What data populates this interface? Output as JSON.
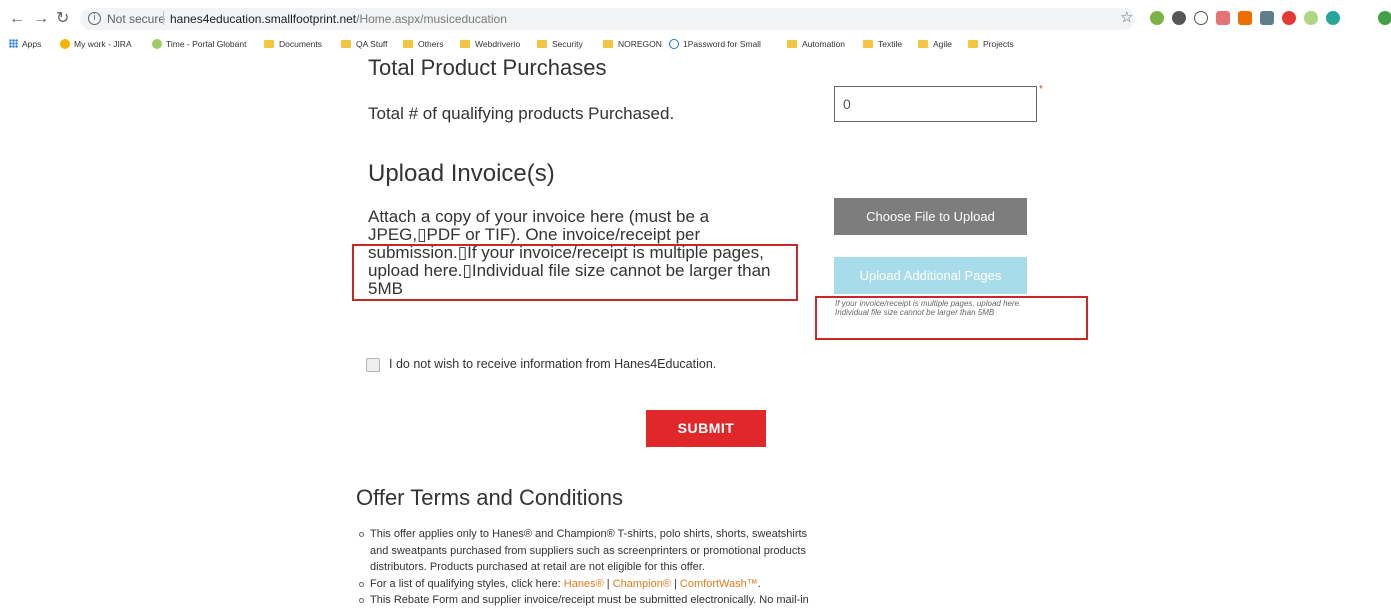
{
  "browser": {
    "not_secure": "Not secure",
    "url_host": "hanes4education.smallfootprint.net",
    "url_path": "/Home.aspx/musiceducation",
    "bookmarks": [
      "Apps",
      "My work - JIRA",
      "Time - Portal Globant",
      "Documents",
      "QA Stuff",
      "Others",
      "Webdriverio",
      "Security",
      "NOREGON",
      "1Password for Small",
      "Automation",
      "Textile",
      "Agile",
      "Projects"
    ]
  },
  "form": {
    "purchases_heading": "Total Product Purchases",
    "qty_label": "Total # of qualifying products Purchased.",
    "qty_value": "0",
    "required_marker": "*",
    "upload_heading": "Upload Invoice(s)",
    "attach_line1": "Attach a copy of your invoice here (must be a",
    "attach_line2": "JPEG,▯PDF or TIF). One invoice/receipt per",
    "attach_line3": "submission.▯If your invoice/receipt is multiple pages,",
    "attach_line4": "upload here.▯Individual file size cannot be larger than",
    "attach_line5": "5MB",
    "choose_file_label": "Choose File to Upload",
    "additional_pages_label": "Upload Additional Pages",
    "hint_text": "If your invoice/receipt is multiple pages, upload here. Individual file size cannot be larger than 5MB",
    "optout_label": "I do not wish to receive information from Hanes4Education.",
    "submit_label": "SUBMIT"
  },
  "terms": {
    "heading": "Offer Terms and Conditions",
    "item1": "This offer applies only to Hanes® and Champion® T-shirts, polo shirts, shorts, sweatshirts and sweatpants purchased from suppliers such as screenprinters or promotional products distributors. Products purchased at retail are not eligible for this offer.",
    "item2_prefix": "For a list of qualifying styles, click here: ",
    "link_hanes": "Hanes®",
    "sep": " | ",
    "link_champion": "Champion®",
    "link_comfortwash": "ComfortWash™",
    "item2_suffix": ".",
    "item3": "This Rebate Form and supplier invoice/receipt must be submitted electronically. No mail-in submissions."
  },
  "colors": {
    "submit": "#e0282a",
    "choose": "#7d7d7d",
    "additional": "#a9dcea",
    "annotation": "#c62828",
    "link": "#e07b1f"
  }
}
